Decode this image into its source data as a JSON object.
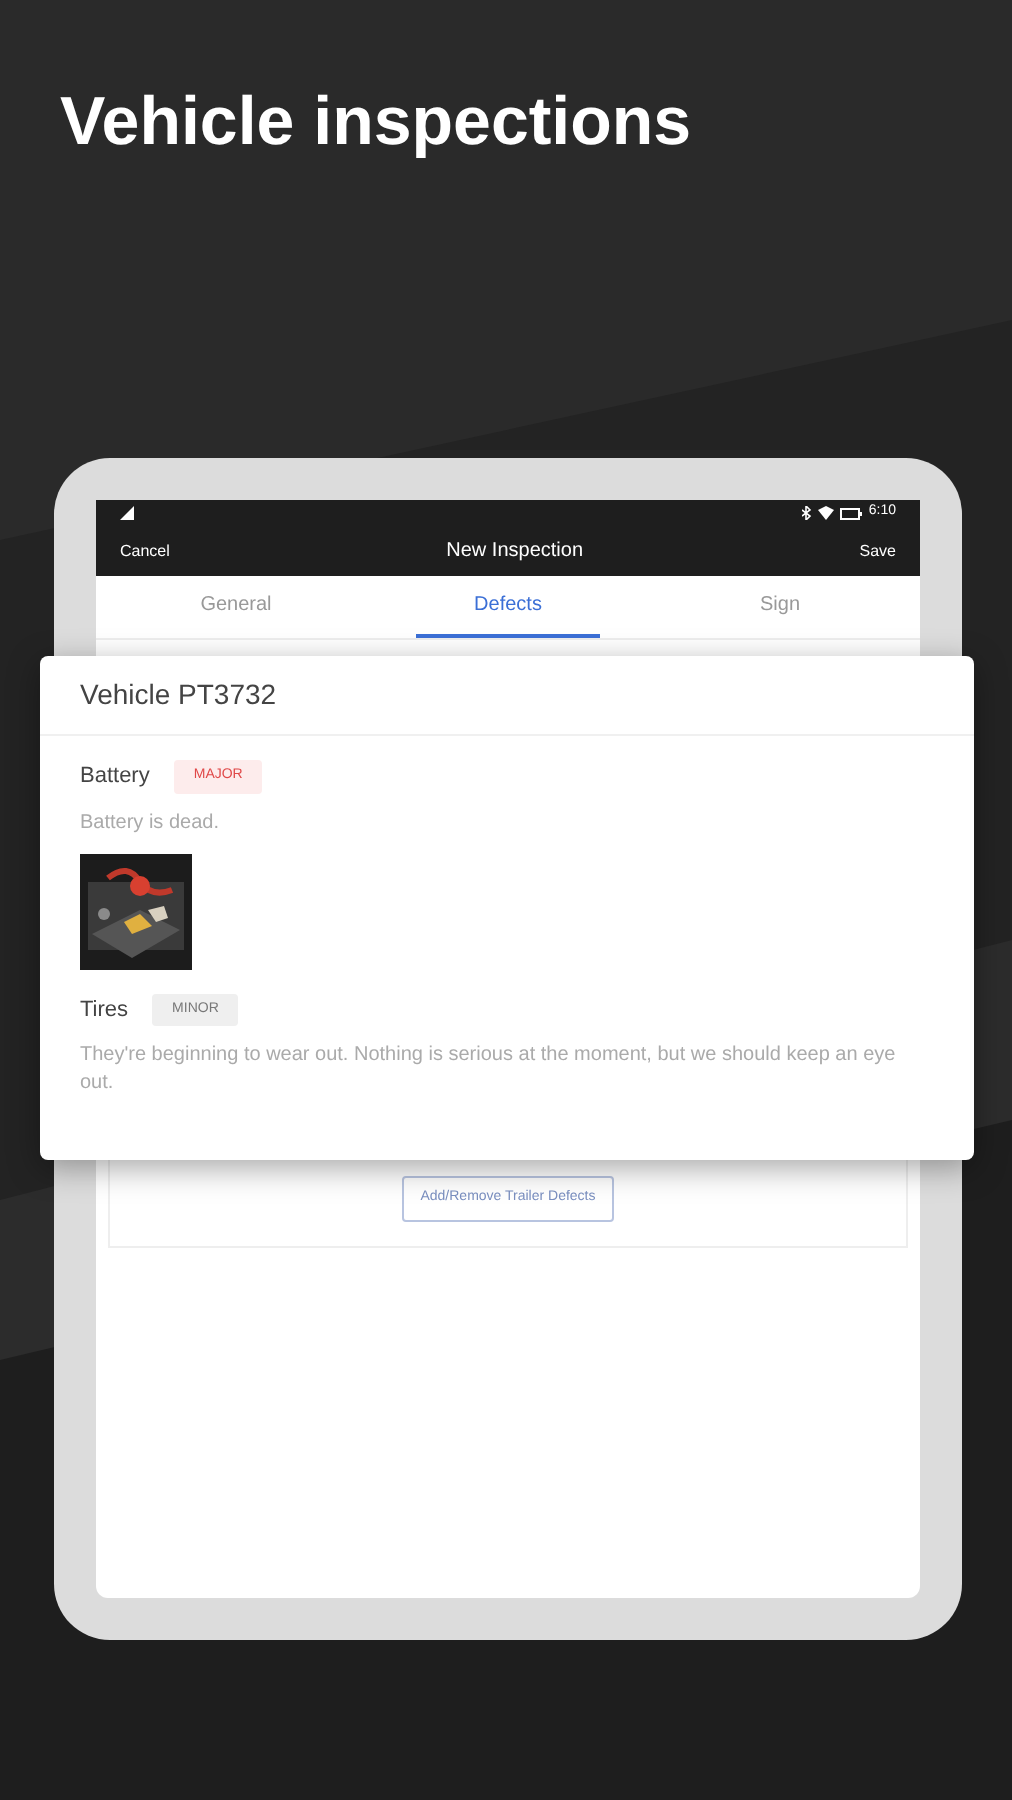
{
  "headline": "Vehicle inspections",
  "status_bar": {
    "time": "6:10"
  },
  "app_bar": {
    "left": "Cancel",
    "title": "New Inspection",
    "right": "Save"
  },
  "tabs": [
    {
      "label": "General",
      "selected": false
    },
    {
      "label": "Defects",
      "selected": true
    },
    {
      "label": "Sign",
      "selected": false
    }
  ],
  "add_button": "Add/Remove Trailer Defects",
  "card": {
    "title": "Vehicle PT3732",
    "defects": [
      {
        "name": "Battery",
        "severity": "MAJOR",
        "kind": "major",
        "note": "Battery is dead."
      },
      {
        "name": "Tires",
        "severity": "MINOR",
        "kind": "minor",
        "note": "They're beginning to wear out. Nothing is serious at the moment, but we should keep an eye out."
      }
    ]
  }
}
